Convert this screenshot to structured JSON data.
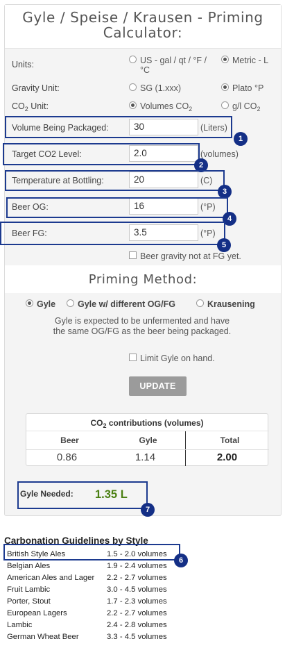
{
  "title": "Gyle / Speise / Krausen - Priming Calculator:",
  "settings": {
    "units": {
      "label": "Units:",
      "opt_us": "US - gal / qt / °F / °C",
      "opt_metric": "Metric - L",
      "selected": "Metric - L"
    },
    "gravity": {
      "label": "Gravity Unit:",
      "opt_sg": "SG (1.xxx)",
      "opt_plato": "Plato °P",
      "selected": "Plato °P"
    },
    "co2": {
      "label_prefix": "CO",
      "label_sub": "2",
      "label_suffix": " Unit:",
      "opt_vol_prefix": "Volumes CO",
      "opt_vol_sub": "2",
      "opt_gl_prefix": "g/l CO",
      "opt_gl_sub": "2",
      "selected": "Volumes CO2"
    }
  },
  "fields": {
    "volume": {
      "label": "Volume Being Packaged:",
      "value": "30",
      "unit": "(Liters)",
      "badge": "1"
    },
    "target_co2": {
      "label": "Target CO2 Level:",
      "value": "2.0",
      "unit": "(volumes)",
      "badge": "2"
    },
    "temperature": {
      "label": "Temperature at Bottling:",
      "value": "20",
      "unit": "(C)",
      "badge": "3"
    },
    "og": {
      "label": "Beer OG:",
      "value": "16",
      "unit": "(°P)",
      "badge": "4"
    },
    "fg": {
      "label": "Beer FG:",
      "value": "3.5",
      "unit": "(°P)",
      "badge": "5"
    }
  },
  "beer_not_at_fg": "Beer gravity not at FG yet.",
  "priming_method": {
    "title": "Priming Method:",
    "options": [
      "Gyle",
      "Gyle w/ different OG/FG",
      "Krausening"
    ],
    "selected": "Gyle",
    "description_line1": "Gyle is expected to be unfermented and have",
    "description_line2": "the same OG/FG as the beer being packaged.",
    "limit_gyle": "Limit Gyle on hand.",
    "update_button": "UPDATE"
  },
  "co2_table": {
    "title_prefix": "CO",
    "title_sub": "2",
    "title_suffix": " contributions (volumes)",
    "headers": [
      "Beer",
      "Gyle",
      "Total"
    ],
    "values": [
      "0.86",
      "1.14",
      "2.00"
    ]
  },
  "gyle_needed": {
    "label": "Gyle Needed:",
    "value": "1.35 L",
    "badge": "7"
  },
  "guidelines": {
    "title": "Carbonation Guidelines by Style",
    "badge": "6",
    "rows": [
      {
        "style": "British Style Ales",
        "range": "1.5 - 2.0 volumes"
      },
      {
        "style": "Belgian Ales",
        "range": "1.9 - 2.4 volumes"
      },
      {
        "style": "American Ales and Lager",
        "range": "2.2 - 2.7 volumes"
      },
      {
        "style": "Fruit Lambic",
        "range": "3.0 - 4.5 volumes"
      },
      {
        "style": "Porter, Stout",
        "range": "1.7 - 2.3 volumes"
      },
      {
        "style": "European Lagers",
        "range": "2.2 - 2.7 volumes"
      },
      {
        "style": "Lambic",
        "range": "2.4 - 2.8 volumes"
      },
      {
        "style": "German Wheat Beer",
        "range": "3.3 - 4.5 volumes"
      }
    ]
  },
  "colors": {
    "badge": "#142f86",
    "highlight": "#1c3a8f",
    "gyle_value": "#4a7f12",
    "update_button": "#9b9b9b"
  }
}
